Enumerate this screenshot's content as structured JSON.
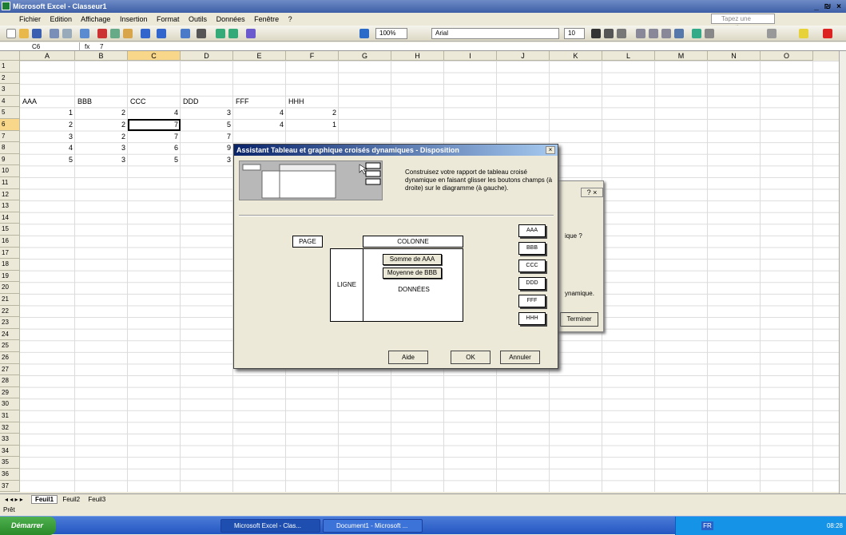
{
  "window": {
    "title": "Microsoft Excel - Classeur1",
    "controls": "_ ₪ ×"
  },
  "menu": {
    "items": [
      "Fichier",
      "Edition",
      "Affichage",
      "Insertion",
      "Format",
      "Outils",
      "Données",
      "Fenêtre",
      "?"
    ],
    "help_placeholder": "Tapez une question"
  },
  "toolbar": {
    "zoom": "100%",
    "font": "Arial",
    "size": "10"
  },
  "formula": {
    "cell": "C6",
    "fx": "fx",
    "value": "7"
  },
  "columns": [
    "A",
    "B",
    "C",
    "D",
    "E",
    "F",
    "G",
    "H",
    "I",
    "J",
    "K",
    "L",
    "M",
    "N",
    "O"
  ],
  "rows": [
    "1",
    "2",
    "3",
    "4",
    "5",
    "6",
    "7",
    "8",
    "9",
    "10",
    "11",
    "12",
    "13",
    "14",
    "15",
    "16",
    "17",
    "18",
    "19",
    "20",
    "21",
    "22",
    "23",
    "24",
    "25",
    "26",
    "27",
    "28",
    "29",
    "30",
    "31",
    "32",
    "33",
    "34",
    "35",
    "36",
    "37"
  ],
  "sheet": {
    "headers": [
      "AAA",
      "BBB",
      "CCC",
      "DDD",
      "FFF",
      "HHH"
    ],
    "data": [
      [
        "1",
        "2",
        "4",
        "3",
        "4",
        "2"
      ],
      [
        "2",
        "2",
        "7",
        "5",
        "4",
        "1"
      ],
      [
        "3",
        "2",
        "7",
        "7",
        "",
        "",
        ""
      ],
      [
        "4",
        "3",
        "6",
        "9",
        "",
        ""
      ],
      [
        "5",
        "3",
        "5",
        "3",
        "",
        ""
      ]
    ]
  },
  "sheet_tabs": [
    "Feuil1",
    "Feuil2",
    "Feuil3"
  ],
  "status": "Prêt",
  "taskbar": {
    "start": "Démarrer",
    "items": [
      "Microsoft Excel - Clas...",
      "Document1 - Microsoft ..."
    ],
    "lang": "FR",
    "time": "08:28"
  },
  "back_dialog": {
    "help": "? ×",
    "text1": "ique ?",
    "text2": "ynamique.",
    "finish": "Terminer"
  },
  "dialog": {
    "title": "Assistant Tableau et graphique croisés dynamiques - Disposition",
    "close": "×",
    "instructions": "Construisez votre rapport de tableau croisé dynamique en faisant glisser les boutons champs (à droite) sur le diagramme (à gauche).",
    "page": "PAGE",
    "column": "COLONNE",
    "row": "LIGNE",
    "data": "DONNÉES",
    "data_fields": [
      "Somme de AAA",
      "Moyenne de BBB"
    ],
    "field_buttons": [
      "AAA",
      "BBB",
      "CCC",
      "DDD",
      "FFF",
      "HHH"
    ],
    "buttons": {
      "help": "Aide",
      "ok": "OK",
      "cancel": "Annuler"
    }
  }
}
